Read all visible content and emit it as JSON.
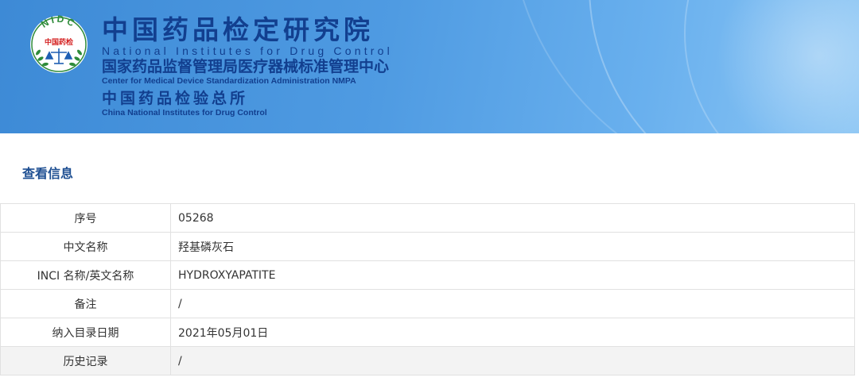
{
  "header": {
    "logo": {
      "ring_text": "NIDC",
      "center_text": "中国药检",
      "colors": {
        "green": "#2e8b3a",
        "red": "#d42020",
        "blue": "#1f5fb3"
      }
    },
    "title_cn": "中国药品检定研究院",
    "title_en": "National Institutes for Drug Control",
    "subtitle_cn": "国家药品监督管理局医疗器械标准管理中心",
    "subtitle_en": "Center for Medical Device Standardization Administration NMPA",
    "subtitle2_cn": "中国药品检验总所",
    "subtitle2_en": "China National Institutes for Drug Control"
  },
  "section": {
    "title": "查看信息"
  },
  "table": {
    "rows": [
      {
        "label": "序号",
        "value": "05268"
      },
      {
        "label": "中文名称",
        "value": "羟基磷灰石"
      },
      {
        "label": "INCI 名称/英文名称",
        "value": "HYDROXYAPATITE"
      },
      {
        "label": "备注",
        "value": "/"
      },
      {
        "label": "纳入目录日期",
        "value": "2021年05月01日"
      },
      {
        "label": "历史记录",
        "value": "/"
      }
    ]
  },
  "colors": {
    "banner_blue": "#4f9be2",
    "title_navy": "#123f8f",
    "section_title": "#1e4f92"
  }
}
